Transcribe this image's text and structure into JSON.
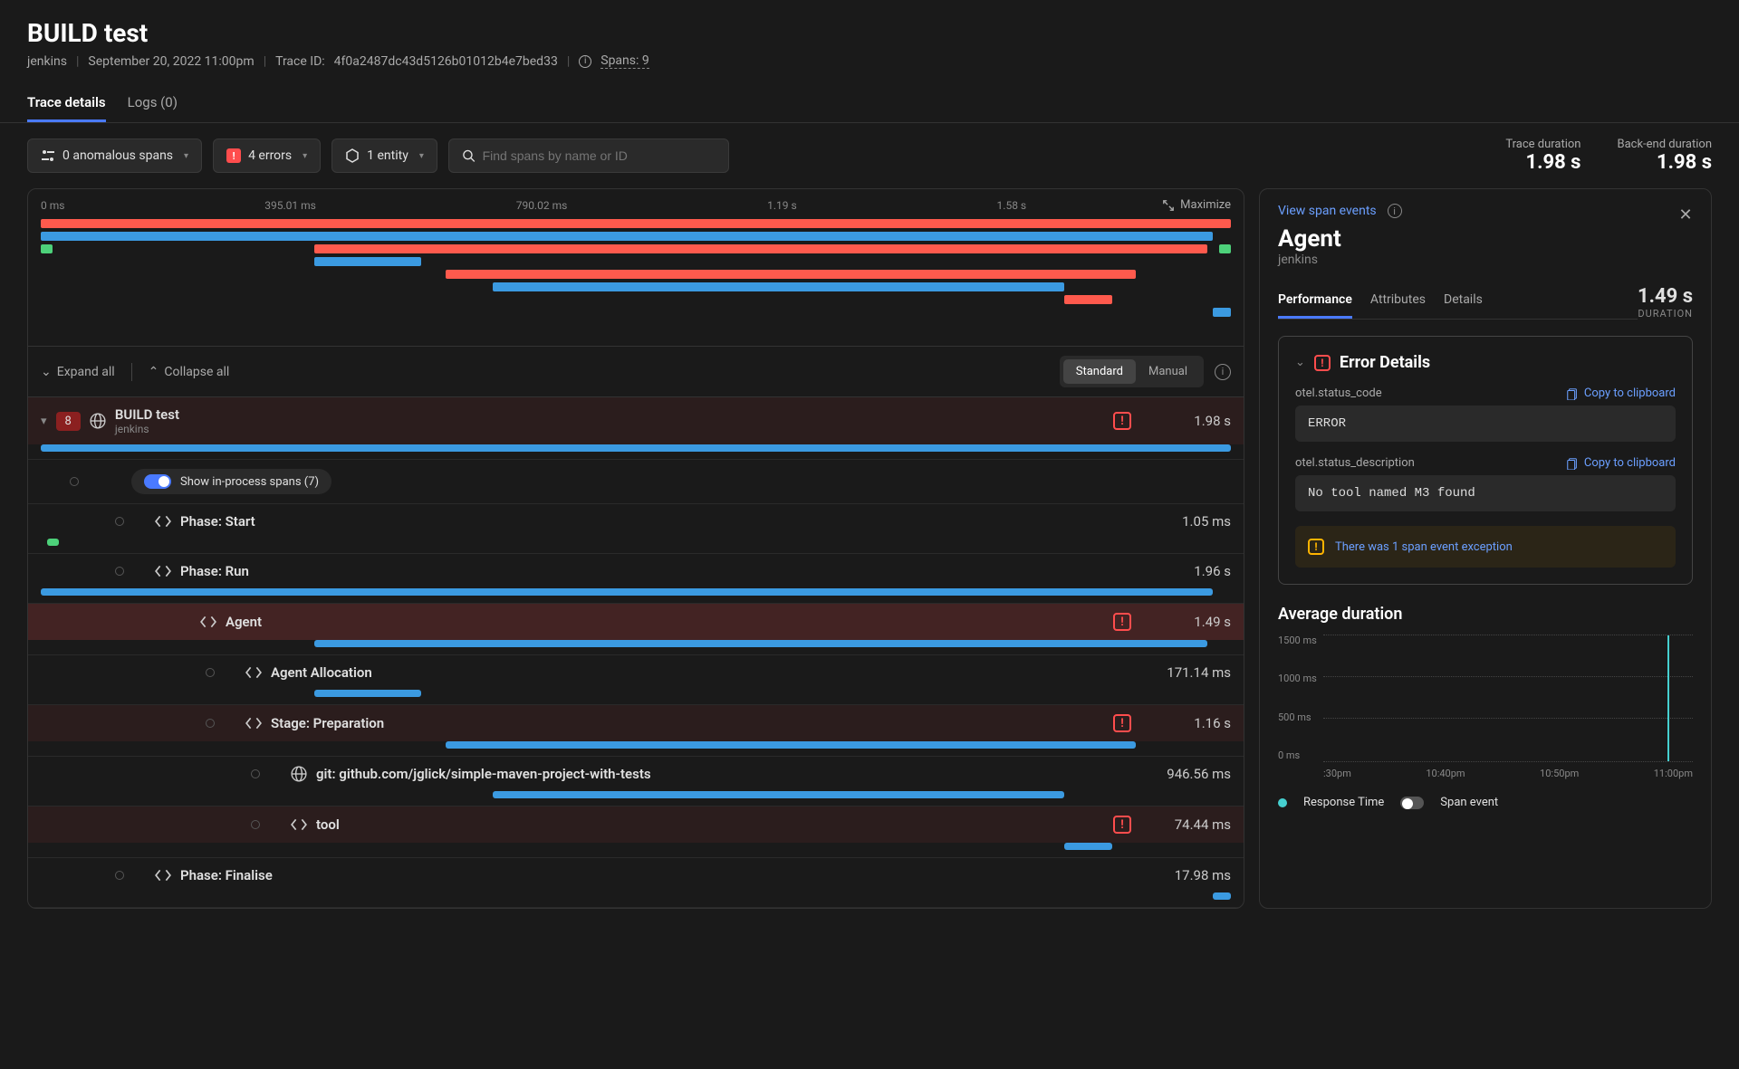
{
  "header": {
    "title": "BUILD test",
    "service": "jenkins",
    "timestamp": "September 20, 2022 11:00pm",
    "trace_id_label": "Trace ID:",
    "trace_id": "4f0a2487dc43d5126b01012b4e7bed33",
    "spans_label": "Spans: 9"
  },
  "tabs": {
    "trace_details": "Trace details",
    "logs": "Logs (0)"
  },
  "toolbar": {
    "anomalous": "0 anomalous spans",
    "errors": "4 errors",
    "entity": "1 entity",
    "search_placeholder": "Find spans by name or ID",
    "trace_duration_label": "Trace duration",
    "trace_duration_value": "1.98 s",
    "backend_duration_label": "Back-end duration",
    "backend_duration_value": "1.98 s"
  },
  "minimap": {
    "ticks": [
      "0 ms",
      "395.01 ms",
      "790.02 ms",
      "1.19 s",
      "1.58 s"
    ],
    "maximize": "Maximize"
  },
  "controls": {
    "expand_all": "Expand all",
    "collapse_all": "Collapse all",
    "standard": "Standard",
    "manual": "Manual"
  },
  "spans": {
    "root": {
      "badge": "8",
      "name": "BUILD test",
      "sub": "jenkins",
      "dur": "1.98 s"
    },
    "toggle": "Show in-process spans (7)",
    "start": {
      "name": "Phase: Start",
      "dur": "1.05 ms"
    },
    "run": {
      "name": "Phase: Run",
      "dur": "1.96 s"
    },
    "agent": {
      "name": "Agent",
      "dur": "1.49 s"
    },
    "alloc": {
      "name": "Agent Allocation",
      "dur": "171.14 ms"
    },
    "prep": {
      "name": "Stage: Preparation",
      "dur": "1.16 s"
    },
    "git": {
      "name": "git: github.com/jglick/simple-maven-project-with-tests",
      "dur": "946.56 ms"
    },
    "tool": {
      "name": "tool",
      "dur": "74.44 ms"
    },
    "finalise": {
      "name": "Phase: Finalise",
      "dur": "17.98 ms"
    }
  },
  "right_panel": {
    "view_events": "View span events",
    "title": "Agent",
    "sub": "jenkins",
    "duration_value": "1.49 s",
    "duration_label": "DURATION",
    "tabs": {
      "performance": "Performance",
      "attributes": "Attributes",
      "details": "Details"
    },
    "error_details": {
      "title": "Error Details",
      "status_code_key": "otel.status_code",
      "status_code_val": "ERROR",
      "status_desc_key": "otel.status_description",
      "status_desc_val": "No tool named M3 found",
      "copy": "Copy to clipboard",
      "exception_msg": "There was 1 span event exception"
    },
    "avg_title": "Average duration",
    "legend": {
      "response": "Response Time",
      "span_event": "Span event"
    }
  },
  "chart_data": {
    "type": "line",
    "title": "Average duration",
    "xlabel": "",
    "ylabel": "",
    "ylim": [
      0,
      1500
    ],
    "y_ticks": [
      "1500 ms",
      "1000 ms",
      "500 ms",
      "0 ms"
    ],
    "x_ticks": [
      ":30pm",
      "10:40pm",
      "10:50pm",
      "11:00pm"
    ],
    "series": [
      {
        "name": "Response Time",
        "color": "#46d0d0",
        "x": [
          ":30pm",
          "10:40pm",
          "10:50pm",
          "11:00pm"
        ],
        "values": [
          0,
          0,
          0,
          1490
        ]
      }
    ]
  }
}
